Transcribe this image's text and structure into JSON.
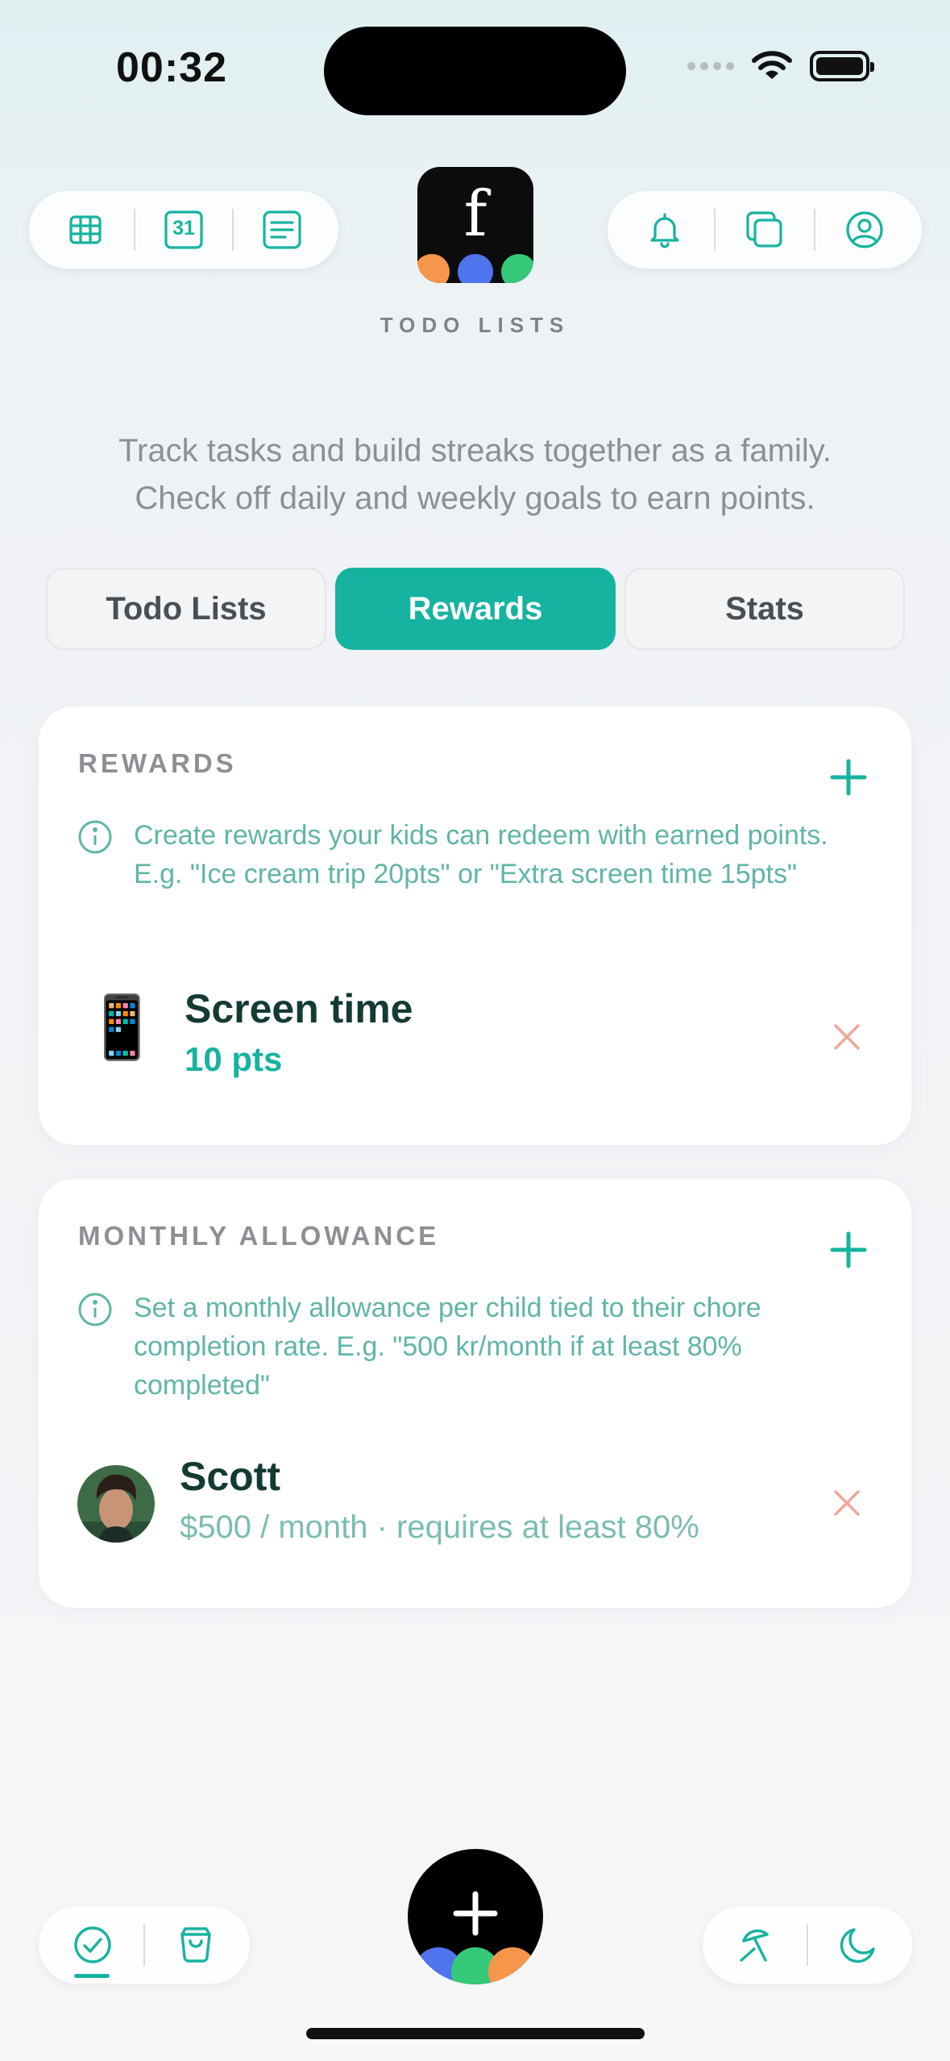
{
  "status": {
    "time": "00:32"
  },
  "header": {
    "app_title": "TODO LISTS",
    "logo_letter": "f",
    "subtitle_line1": "Track tasks and build streaks together as a family.",
    "subtitle_line2": "Check off daily and weekly goals to earn points.",
    "left_icons": [
      "grid-icon",
      "calendar-31-icon",
      "list-icon"
    ],
    "calendar_number": "31",
    "right_icons": [
      "bell-icon",
      "copy-icon",
      "profile-icon"
    ]
  },
  "tabs": [
    {
      "label": "Todo Lists",
      "active": false
    },
    {
      "label": "Rewards",
      "active": true
    },
    {
      "label": "Stats",
      "active": false
    }
  ],
  "rewards": {
    "title": "REWARDS",
    "info": "Create rewards your kids can redeem with earned points. E.g. \"Ice cream trip 20pts\" or \"Extra screen time 15pts\"",
    "items": [
      {
        "emoji": "📱",
        "name": "Screen time",
        "points": "10 pts"
      }
    ]
  },
  "allowance": {
    "title": "MONTHLY ALLOWANCE",
    "info": "Set a monthly allowance per child tied to their chore completion rate. E.g. \"500 kr/month if at least 80% completed\"",
    "items": [
      {
        "name": "Scott",
        "detail": "$500 / month · requires at least 80%"
      }
    ]
  },
  "bottom_bar": {
    "left_icons": [
      "check-circle-icon",
      "bag-icon"
    ],
    "right_icons": [
      "umbrella-icon",
      "moon-icon"
    ],
    "fab_icon": "plus-icon"
  },
  "colors": {
    "accent": "#16b3a0",
    "accent_text": "#5fb5a8",
    "delete": "#f0a79c",
    "dot_orange": "#f7964a",
    "dot_blue": "#4f74ee",
    "dot_green": "#35c97a"
  }
}
